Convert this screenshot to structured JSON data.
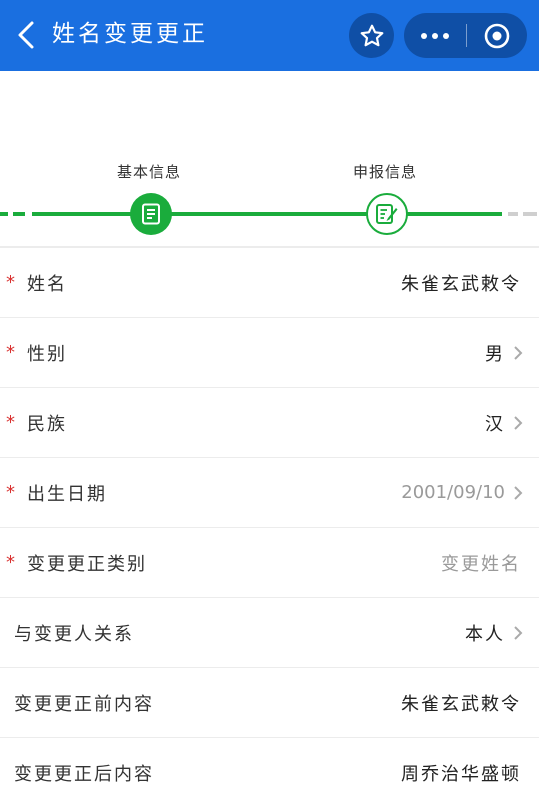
{
  "header": {
    "title": "姓名变更更正",
    "back_icon": "chevron-left-icon",
    "favorite_icon": "star-icon",
    "more_icon": "more-dots-icon",
    "close_icon": "target-close-icon",
    "bg_color": "#1a6fe0"
  },
  "steps": [
    {
      "label": "基本信息",
      "icon": "document-icon",
      "state": "done"
    },
    {
      "label": "申报信息",
      "icon": "edit-form-icon",
      "state": "current"
    }
  ],
  "colors": {
    "accent": "#1aac3c",
    "required": "#d9302f"
  },
  "form": {
    "rows": [
      {
        "label": "姓名",
        "required": true,
        "value": "朱雀玄武敕令",
        "arrow": false,
        "muted": false
      },
      {
        "label": "性别",
        "required": true,
        "value": "男",
        "arrow": true,
        "muted": false
      },
      {
        "label": "民族",
        "required": true,
        "value": "汉",
        "arrow": true,
        "muted": false
      },
      {
        "label": "出生日期",
        "required": true,
        "value": "2001/09/10",
        "arrow": true,
        "muted": true
      },
      {
        "label": "变更更正类别",
        "required": true,
        "value": "变更姓名",
        "arrow": false,
        "muted": true
      },
      {
        "label": "与变更人关系",
        "required": false,
        "value": "本人",
        "arrow": true,
        "muted": false
      },
      {
        "label": "变更更正前内容",
        "required": false,
        "value": "朱雀玄武敕令",
        "arrow": false,
        "muted": false
      },
      {
        "label": "变更更正后内容",
        "required": false,
        "value": "周乔治华盛顿",
        "arrow": false,
        "muted": false
      }
    ],
    "required_mark": "*"
  }
}
